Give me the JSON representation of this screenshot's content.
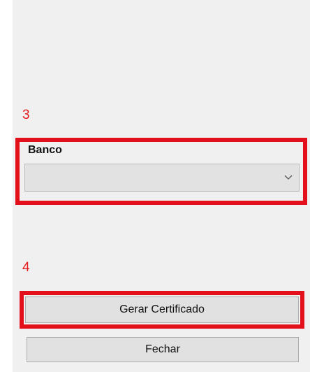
{
  "steps": {
    "step3": "3",
    "step4": "4"
  },
  "bank_field": {
    "label": "Banco",
    "value": "",
    "icon": "chevron-down-icon"
  },
  "buttons": {
    "generate": "Gerar Certificado",
    "close": "Fechar"
  },
  "colors": {
    "highlight": "#e3101c",
    "step_number": "#e31b1b",
    "window_bg": "#f0f0f0"
  }
}
